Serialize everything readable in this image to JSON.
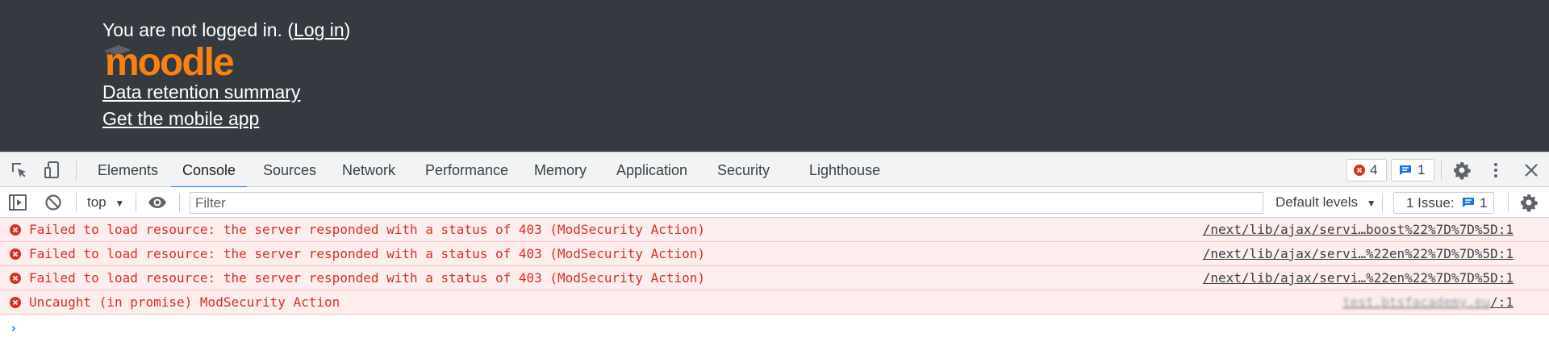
{
  "footer": {
    "login_prefix": "You are not logged in. (",
    "login_link": "Log in",
    "login_suffix": ")",
    "logo_text": "moodle",
    "data_retention_link": "Data retention summary",
    "mobile_app_link": "Get the mobile app",
    "background_color": "#343a40",
    "logo_color": "#f98012"
  },
  "devtools": {
    "tabs": [
      {
        "label": "Elements",
        "active": false
      },
      {
        "label": "Console",
        "active": true
      },
      {
        "label": "Sources",
        "active": false
      },
      {
        "label": "Network",
        "active": false
      },
      {
        "label": "Performance",
        "active": false
      },
      {
        "label": "Memory",
        "active": false
      },
      {
        "label": "Application",
        "active": false
      },
      {
        "label": "Security",
        "active": false
      },
      {
        "label": "Lighthouse",
        "active": false
      }
    ],
    "error_count": "4",
    "message_count": "1",
    "toolbar": {
      "context": "top",
      "filter_placeholder": "Filter",
      "levels": "Default levels",
      "issues_label": "1 Issue:",
      "issues_count": "1"
    },
    "messages": [
      {
        "level": "error",
        "text": "Failed to load resource: the server responded with a status of 403 (ModSecurity Action)",
        "source": "/next/lib/ajax/servi…boost%22%7D%7D%5D:1"
      },
      {
        "level": "error",
        "text": "Failed to load resource: the server responded with a status of 403 (ModSecurity Action)",
        "source": "/next/lib/ajax/servi…%22en%22%7D%7D%5D:1"
      },
      {
        "level": "error",
        "text": "Failed to load resource: the server responded with a status of 403 (ModSecurity Action)",
        "source": "/next/lib/ajax/servi…%22en%22%7D%7D%5D:1"
      },
      {
        "level": "error",
        "text": "Uncaught (in promise) ModSecurity Action",
        "source_host_blurred": "test.btsfacademy.eu",
        "source": "/:1"
      }
    ],
    "prompt_symbol": "›",
    "colors": {
      "accent": "#1a73e8",
      "error": "#d93025",
      "error_background": "#fdeded"
    }
  }
}
